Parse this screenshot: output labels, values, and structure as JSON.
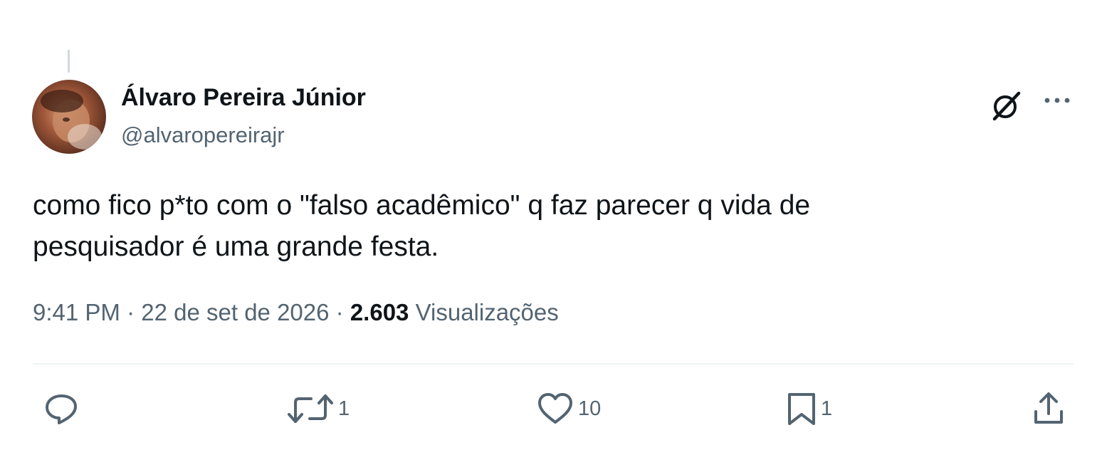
{
  "author": {
    "display_name": "Álvaro Pereira Júnior",
    "handle": "@alvaropereirajr"
  },
  "tweet": {
    "text_lines": [
      "como fico p*to com o \"falso acadêmico\" q faz parecer q vida de",
      "pesquisador é uma grande festa."
    ],
    "time": "9:41 PM",
    "date": "22 de set de 2026",
    "separator": "·",
    "views_count": "2.603",
    "views_label": "Visualizações"
  },
  "actions": {
    "reply": {
      "icon": "reply-icon",
      "count": ""
    },
    "retweet": {
      "icon": "retweet-icon",
      "count": "1"
    },
    "like": {
      "icon": "heart-icon",
      "count": "10"
    },
    "bookmark": {
      "icon": "bookmark-icon",
      "count": "1"
    },
    "share": {
      "icon": "share-icon",
      "count": ""
    }
  },
  "header_icons": [
    "grok-icon",
    "more-icon"
  ],
  "colors": {
    "text": "#0f1419",
    "secondary": "#536471",
    "divider": "#eff3f4",
    "background": "#ffffff"
  }
}
